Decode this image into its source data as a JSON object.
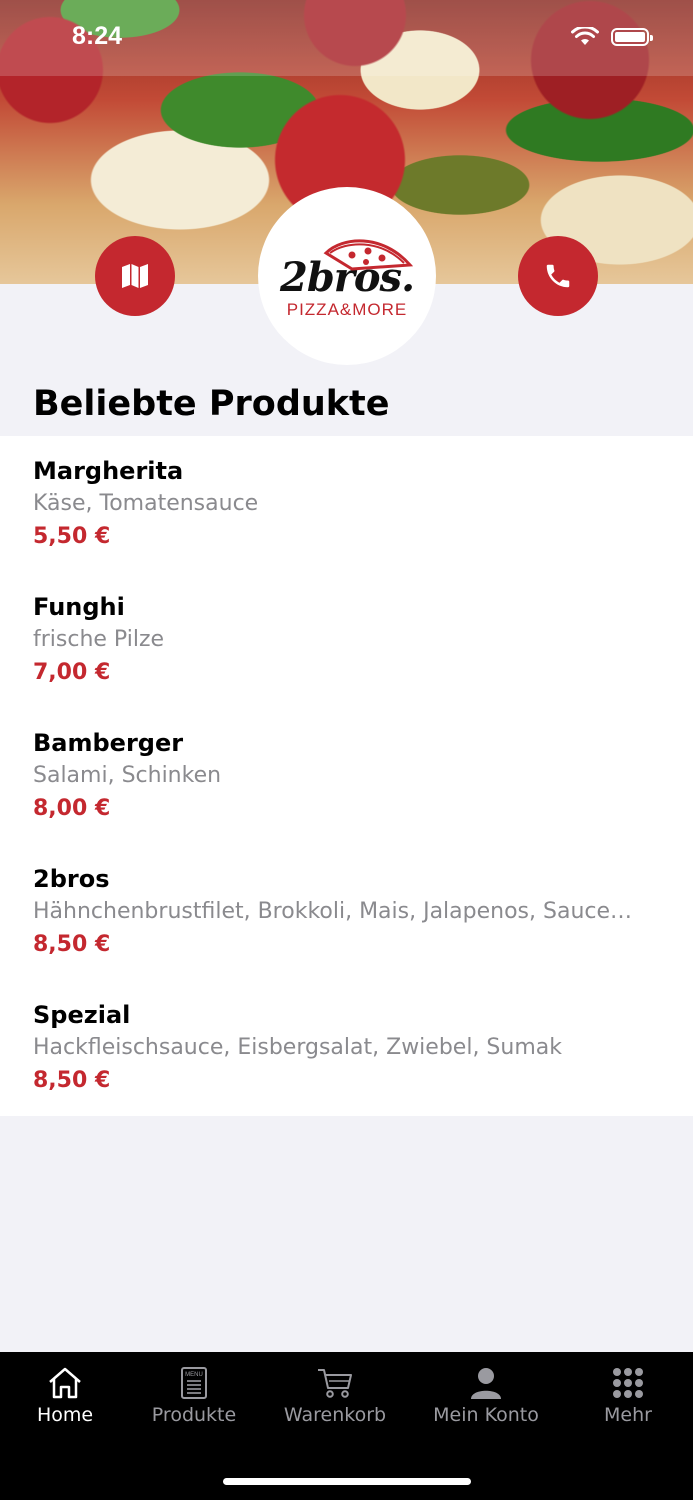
{
  "status_bar": {
    "time": "8:24"
  },
  "logo": {
    "name": "2bros.",
    "tagline": "PIZZA&MORE"
  },
  "section": {
    "title": "Beliebte Produkte"
  },
  "products": [
    {
      "name": "Margherita",
      "description": "Käse, Tomatensauce",
      "price": "5,50 €"
    },
    {
      "name": "Funghi",
      "description": "frische Pilze",
      "price": "7,00 €"
    },
    {
      "name": "Bamberger",
      "description": "Salami, Schinken",
      "price": "8,00 €"
    },
    {
      "name": "2bros",
      "description": "Hähnchenbrustfilet, Brokkoli, Mais, Jalapenos, Sauce…",
      "price": "8,50 €"
    },
    {
      "name": "Spezial",
      "description": "Hackfleischsauce, Eisbergsalat, Zwiebel, Sumak",
      "price": "8,50 €"
    }
  ],
  "tabs": [
    {
      "label": "Home",
      "icon": "home-icon",
      "active": true
    },
    {
      "label": "Produkte",
      "icon": "menu-card-icon",
      "active": false
    },
    {
      "label": "Warenkorb",
      "icon": "cart-icon",
      "active": false
    },
    {
      "label": "Mein Konto",
      "icon": "person-icon",
      "active": false
    },
    {
      "label": "Mehr",
      "icon": "grid-icon",
      "active": false
    }
  ],
  "colors": {
    "accent": "#c4282f",
    "background": "#f2f2f7",
    "tabbar": "#000000",
    "muted_text": "#8a8a8e"
  }
}
